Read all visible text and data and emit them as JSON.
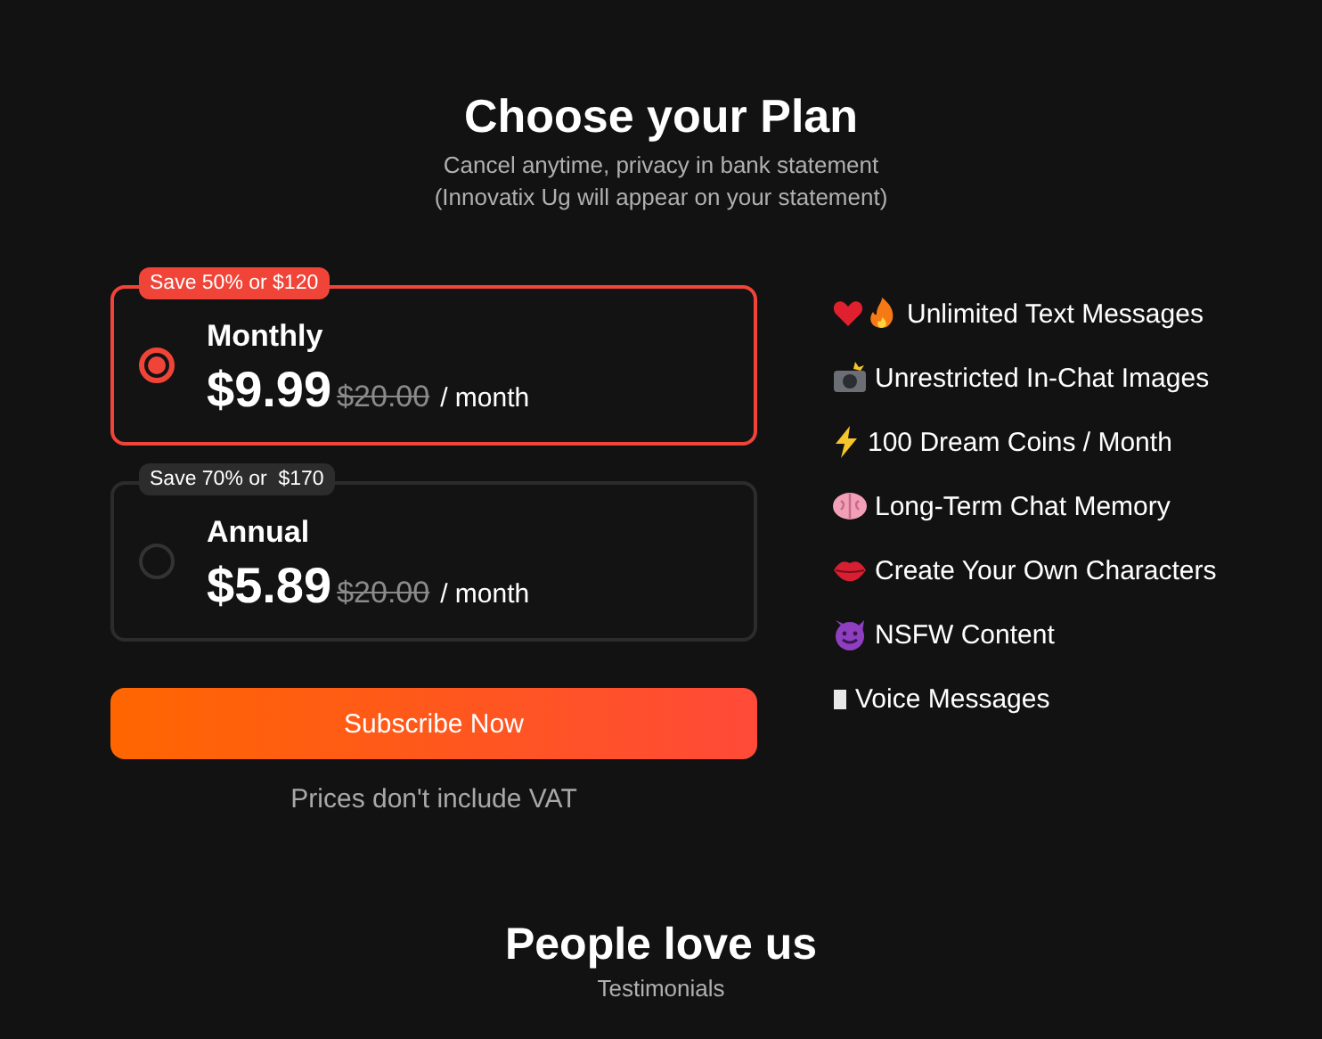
{
  "header": {
    "title": "Choose your Plan",
    "subtitle": "Cancel anytime, privacy in bank statement",
    "note": "(Innovatix Ug will appear on your statement)"
  },
  "plans": [
    {
      "badge": "Save 50% or $120",
      "name": "Monthly",
      "price": "$9.99",
      "old_price": "$20.00",
      "period": "/ month",
      "selected": true
    },
    {
      "badge": "Save 70% or  $170",
      "name": "Annual",
      "price": "$5.89",
      "old_price": "$20.00",
      "period": "/ month",
      "selected": false
    }
  ],
  "subscribe_button": "Subscribe Now",
  "vat_note": "Prices don't include VAT",
  "features": [
    "Unlimited Text Messages",
    "Unrestricted In-Chat Images",
    "100 Dream Coins / Month",
    "Long-Term Chat Memory",
    "Create Your Own Characters",
    "NSFW Content",
    "Voice Messages"
  ],
  "testimonials": {
    "title": "People love us",
    "subtitle": "Testimonials"
  }
}
